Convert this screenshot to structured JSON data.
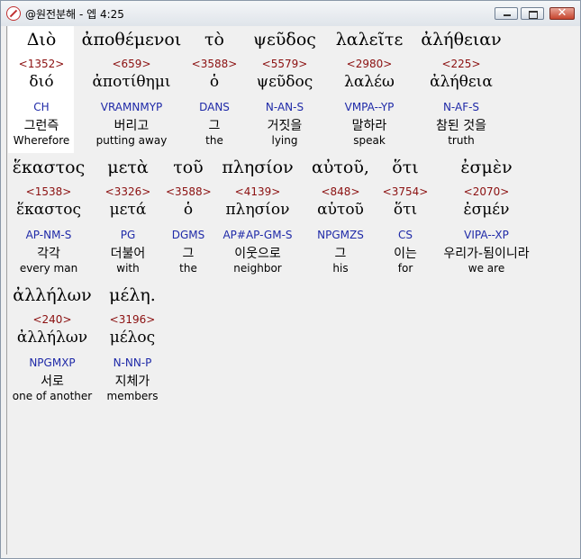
{
  "window": {
    "title": "@원전분해 - 엡 4:25",
    "buttons": {
      "minimize": "",
      "maximize": "",
      "close": "✕"
    }
  },
  "lines": [
    {
      "words": [
        {
          "greek": "Διὸ",
          "number": "<1352>",
          "lemma": "διό",
          "parse": "CH",
          "korean": "그런즉",
          "english": "Wherefore"
        },
        {
          "greek": "ἀποθέμενοι",
          "number": "<659>",
          "lemma": "ἀποτίθημι",
          "parse": "VRAMNMYP",
          "korean": "버리고",
          "english": "putting away"
        },
        {
          "greek": "τὸ",
          "number": "<3588>",
          "lemma": "ὁ",
          "parse": "DANS",
          "korean": "그",
          "english": "the"
        },
        {
          "greek": "ψεῦδος",
          "number": "<5579>",
          "lemma": "ψεῦδος",
          "parse": "N-AN-S",
          "korean": "거짓을",
          "english": "lying"
        },
        {
          "greek": "λαλεῖτε",
          "number": "<2980>",
          "lemma": "λαλέω",
          "parse": "VMPA--YP",
          "korean": "말하라",
          "english": "speak"
        },
        {
          "greek": "ἀλήθειαν",
          "number": "<225>",
          "lemma": "ἀλήθεια",
          "parse": "N-AF-S",
          "korean": "참된 것을",
          "english": "truth"
        }
      ]
    },
    {
      "words": [
        {
          "greek": "ἕκαστος",
          "number": "<1538>",
          "lemma": "ἕκαστος",
          "parse": "AP-NM-S",
          "korean": "각각",
          "english": "every man"
        },
        {
          "greek": "μετὰ",
          "number": "<3326>",
          "lemma": "μετά",
          "parse": "PG",
          "korean": "더불어",
          "english": "with"
        },
        {
          "greek": "τοῦ",
          "number": "<3588>",
          "lemma": "ὁ",
          "parse": "DGMS",
          "korean": "그",
          "english": "the"
        },
        {
          "greek": "πλησίον",
          "number": "<4139>",
          "lemma": "πλησίον",
          "parse": "AP#AP-GM-S",
          "korean": "이웃으로",
          "english": "neighbor"
        },
        {
          "greek": "αὐτοῦ,",
          "number": "<848>",
          "lemma": "αὑτοῦ",
          "parse": "NPGMZS",
          "korean": "그",
          "english": "his"
        },
        {
          "greek": "ὅτι",
          "number": "<3754>",
          "lemma": "ὅτι",
          "parse": "CS",
          "korean": "이는",
          "english": "for"
        },
        {
          "greek": "ἐσμὲν",
          "number": "<2070>",
          "lemma": "ἐσμέν",
          "parse": "VIPA--XP",
          "korean": "우리가-됨이니라",
          "english": "we are"
        }
      ]
    },
    {
      "words": [
        {
          "greek": "ἀλλήλων",
          "number": "<240>",
          "lemma": "ἀλλήλων",
          "parse": "NPGMXP",
          "korean": "서로",
          "english": "one of another"
        },
        {
          "greek": "μέλη.",
          "number": "<3196>",
          "lemma": "μέλος",
          "parse": "N-NN-P",
          "korean": "지체가",
          "english": "members"
        }
      ]
    }
  ]
}
